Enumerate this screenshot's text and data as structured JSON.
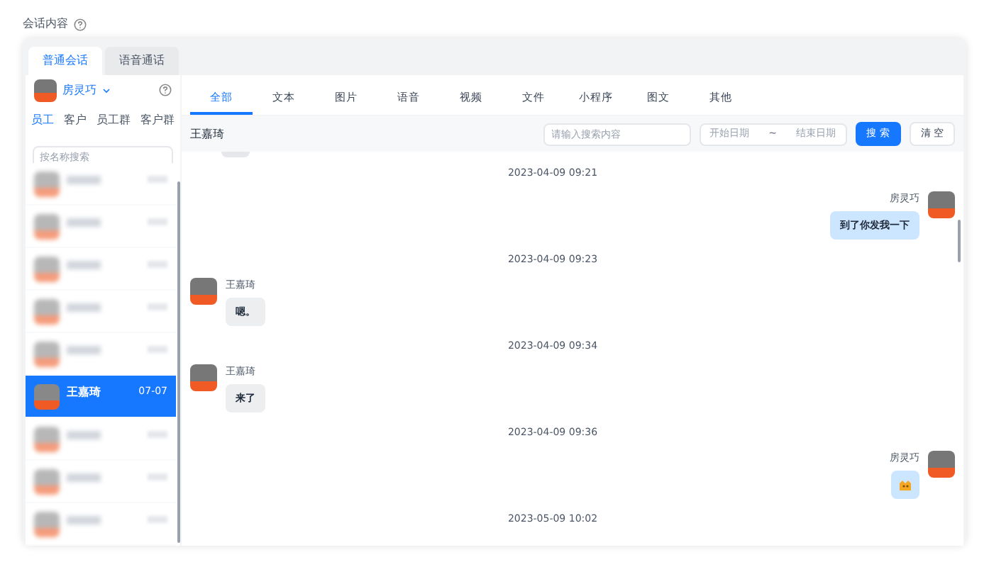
{
  "page_title": "会话内容",
  "session_tabs": [
    {
      "label": "普通会话",
      "selected": true
    },
    {
      "label": "语音通话",
      "selected": false
    }
  ],
  "current_user": {
    "name": "房灵巧"
  },
  "contact_tabs": [
    {
      "label": "员工",
      "selected": true
    },
    {
      "label": "客户",
      "selected": false
    },
    {
      "label": "员工群",
      "selected": false
    },
    {
      "label": "客户群",
      "selected": false
    }
  ],
  "contact_search": {
    "placeholder": "按名称搜索"
  },
  "contacts": [
    {
      "blurred": true,
      "selected": false
    },
    {
      "blurred": true,
      "selected": false
    },
    {
      "blurred": true,
      "selected": false
    },
    {
      "blurred": true,
      "selected": false
    },
    {
      "blurred": true,
      "selected": false
    },
    {
      "blurred": false,
      "selected": true,
      "name": "王嘉琦",
      "time": "07-07"
    },
    {
      "blurred": true,
      "selected": false
    },
    {
      "blurred": true,
      "selected": false
    },
    {
      "blurred": true,
      "selected": false
    }
  ],
  "type_tabs": [
    {
      "label": "全部",
      "selected": true
    },
    {
      "label": "文本",
      "selected": false
    },
    {
      "label": "图片",
      "selected": false
    },
    {
      "label": "语音",
      "selected": false
    },
    {
      "label": "视频",
      "selected": false
    },
    {
      "label": "文件",
      "selected": false
    },
    {
      "label": "小程序",
      "selected": false
    },
    {
      "label": "图文",
      "selected": false
    },
    {
      "label": "其他",
      "selected": false
    }
  ],
  "chat_header": {
    "name": "王嘉琦",
    "search_placeholder": "请输入搜索内容",
    "start_placeholder": "开始日期",
    "separator": "~",
    "end_placeholder": "结束日期",
    "search_button": "搜 索",
    "clear_button": "清 空"
  },
  "messages": [
    {
      "kind": "time",
      "text": "2023-04-09 09:21"
    },
    {
      "kind": "text",
      "outgoing": true,
      "sender": "房灵巧",
      "text": "到了你发我一下"
    },
    {
      "kind": "time",
      "text": "2023-04-09 09:23"
    },
    {
      "kind": "text",
      "outgoing": false,
      "sender": "王嘉琦",
      "text": "嗯。"
    },
    {
      "kind": "time",
      "text": "2023-04-09 09:34"
    },
    {
      "kind": "text",
      "outgoing": false,
      "sender": "王嘉琦",
      "text": "来了"
    },
    {
      "kind": "time",
      "text": "2023-04-09 09:36"
    },
    {
      "kind": "sticker",
      "outgoing": true,
      "sender": "房灵巧"
    },
    {
      "kind": "time",
      "text": "2023-05-09 10:02"
    }
  ]
}
